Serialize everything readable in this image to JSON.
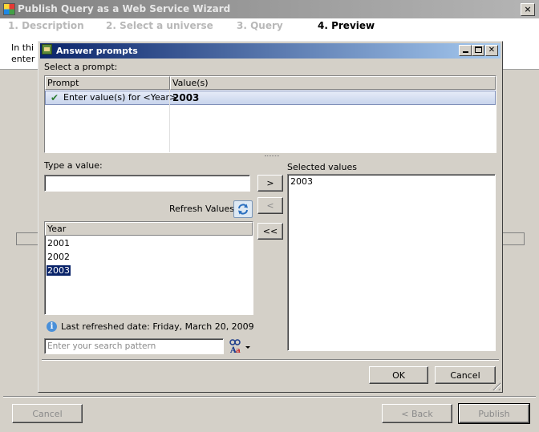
{
  "outer": {
    "title": "Publish Query as a Web Service Wizard",
    "close_glyph": "×",
    "steps": [
      "1. Description",
      "2. Select a universe",
      "3. Query",
      "4. Preview"
    ],
    "intro_line1": "In thi",
    "intro_line2": "enter",
    "buttons": {
      "cancel": "Cancel",
      "back": "< Back",
      "publish": "Publish"
    }
  },
  "dialog": {
    "title": "Answer prompts",
    "select_prompt_label": "Select a prompt:",
    "table": {
      "headers": [
        "Prompt",
        "Value(s)"
      ],
      "rows": [
        {
          "prompt": "Enter value(s) for <Year>",
          "value": "2003"
        }
      ]
    },
    "type_value_label": "Type a value:",
    "type_value": "",
    "refresh_values_label": "Refresh Values",
    "list_header": "Year",
    "list_items": [
      "2001",
      "2002",
      "2003"
    ],
    "selected_list_item": "2003",
    "move_buttons": {
      "add": ">",
      "remove": "<",
      "remove_all": "<<"
    },
    "selected_values_label": "Selected values",
    "selected_values": [
      "2003"
    ],
    "last_refreshed": "Last refreshed date: Friday, March 20, 2009",
    "search_placeholder": "Enter your search pattern",
    "buttons": {
      "ok": "OK",
      "cancel": "Cancel"
    }
  }
}
